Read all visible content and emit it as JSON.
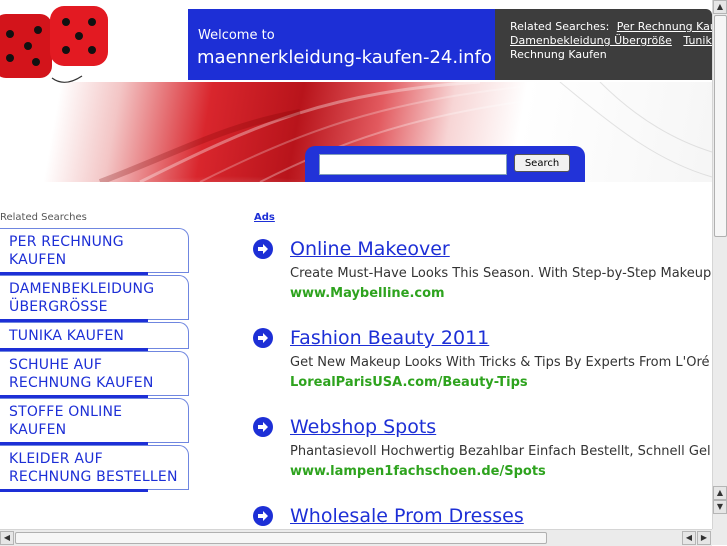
{
  "header": {
    "welcome_small": "Welcome to",
    "domain": "maennerkleidung-kaufen-24.info",
    "related_label": "Related Searches:",
    "related_links": [
      "Per Rechnung Kaufen",
      "Damenbekleidung Übergröße",
      "Tunika Kaufen",
      "Rechnung Kaufen"
    ]
  },
  "search": {
    "placeholder": "",
    "button_label": "Search"
  },
  "sidebar": {
    "title": "Related Searches",
    "items": [
      {
        "label": "PER RECHNUNG KAUFEN"
      },
      {
        "label": "DAMENBEKLEIDUNG ÜBERGRÖSSE"
      },
      {
        "label": "TUNIKA KAUFEN"
      },
      {
        "label": "SCHUHE AUF RECHNUNG KAUFEN"
      },
      {
        "label": "STOFFE ONLINE KAUFEN"
      },
      {
        "label": "KLEIDER AUF RECHNUNG BESTELLEN"
      }
    ]
  },
  "ads": {
    "label": "Ads",
    "items": [
      {
        "title": "Online Makeover",
        "desc": "Create Must-Have Looks This Season. With Step-by-Step Makeup",
        "url": "www.Maybelline.com"
      },
      {
        "title": "Fashion Beauty 2011",
        "desc": "Get New Makeup Looks With Tricks & Tips By Experts From L'Oré",
        "url": "LorealParisUSA.com/Beauty-Tips"
      },
      {
        "title": "Webshop Spots",
        "desc": "Phantasievoll Hochwertig Bezahlbar Einfach Bestellt, Schnell Gel",
        "url": "www.lampen1fachschoen.de/Spots"
      },
      {
        "title": "Wholesale Prom Dresses",
        "desc": "",
        "url": ""
      }
    ]
  },
  "colors": {
    "accent": "#1d2fd6",
    "url_green": "#2ea31e",
    "dark_box": "#3d3d3d"
  }
}
